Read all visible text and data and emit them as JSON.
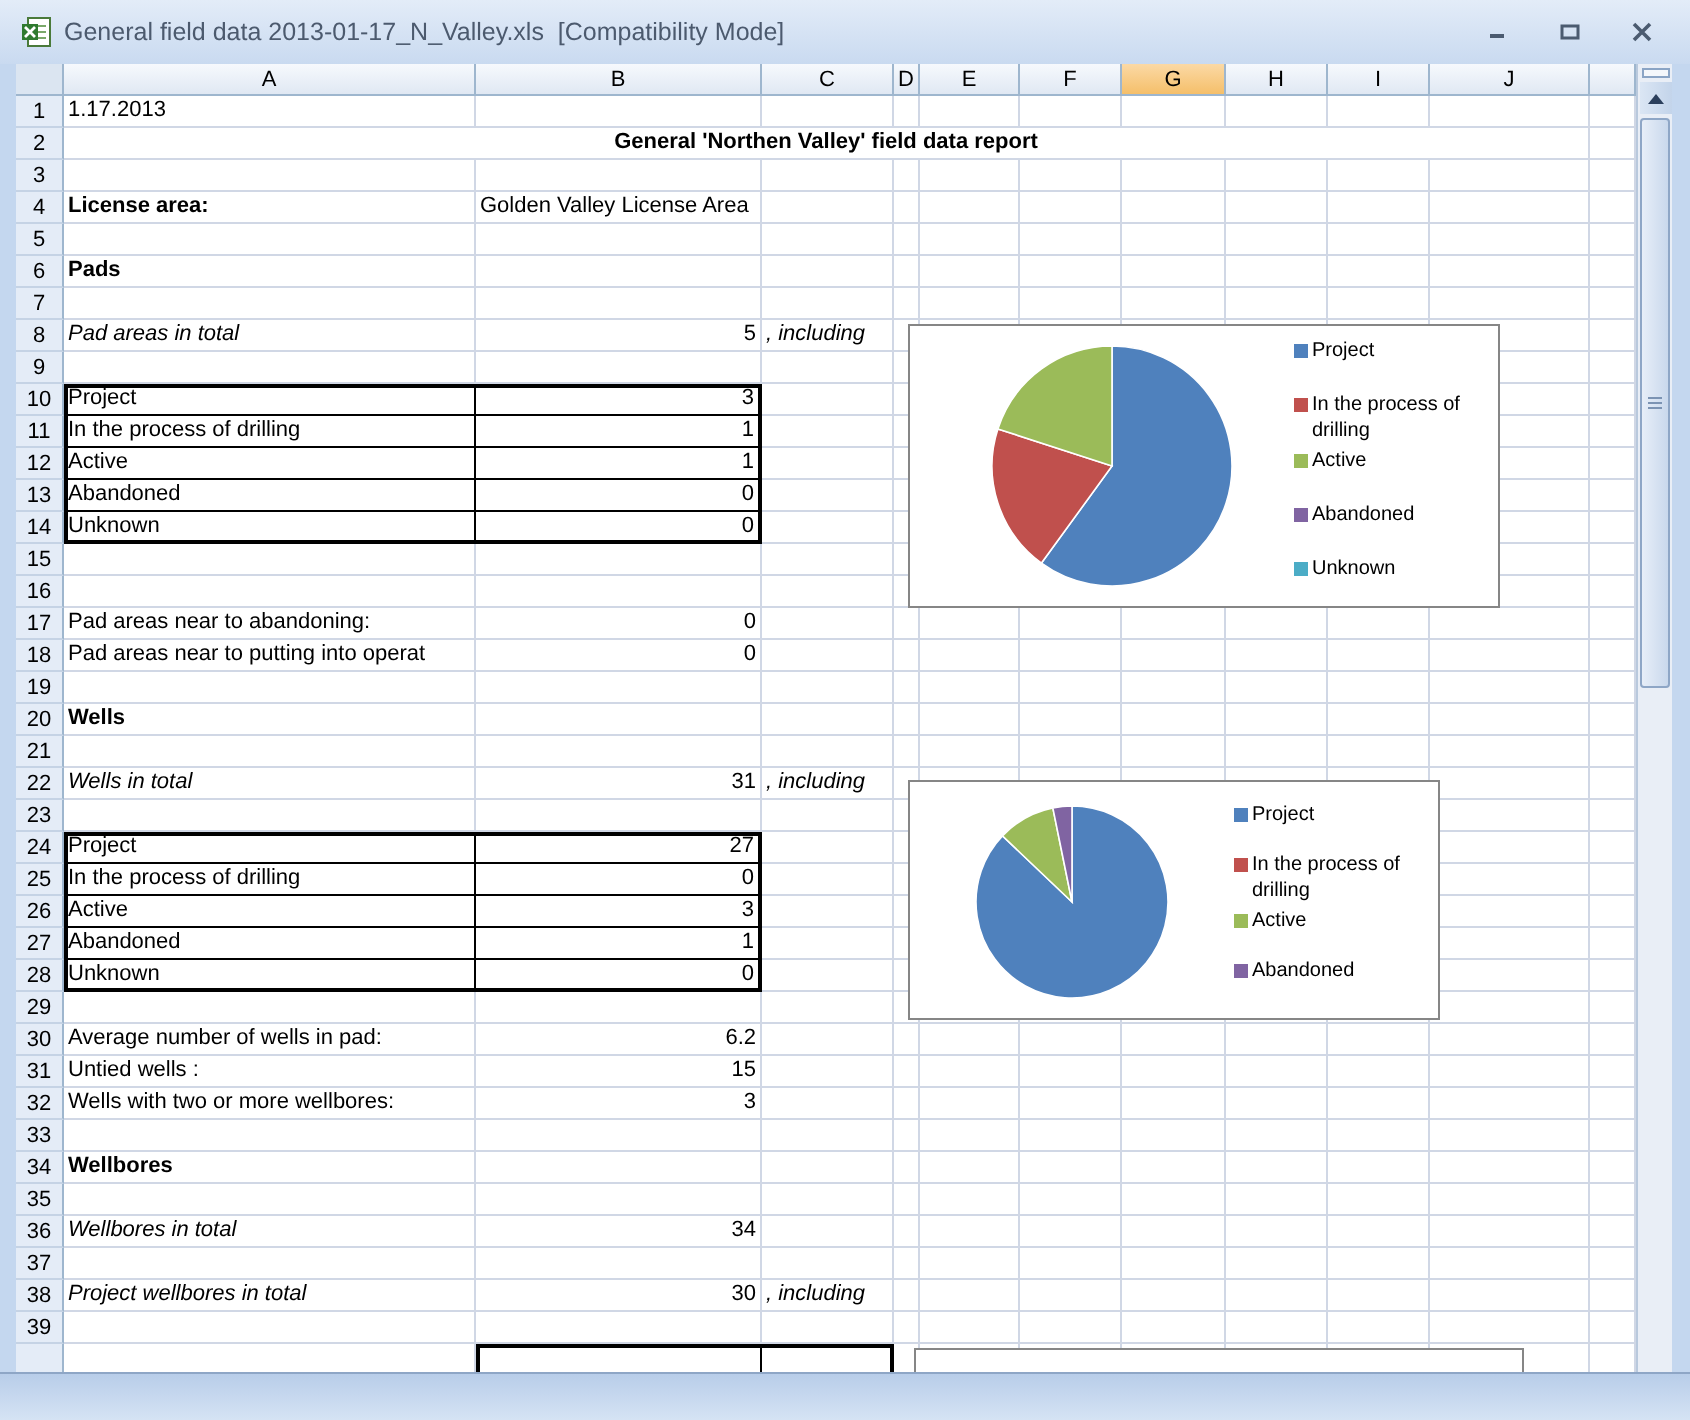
{
  "window": {
    "title": "General field data 2013-01-17_N_Valley.xls  [Compatibility Mode]"
  },
  "columns": [
    {
      "label": "A",
      "selected": false
    },
    {
      "label": "B",
      "selected": false
    },
    {
      "label": "C",
      "selected": false
    },
    {
      "label": "D",
      "selected": false
    },
    {
      "label": "E",
      "selected": false
    },
    {
      "label": "F",
      "selected": false
    },
    {
      "label": "G",
      "selected": true
    },
    {
      "label": "H",
      "selected": false
    },
    {
      "label": "I",
      "selected": false
    },
    {
      "label": "J",
      "selected": false
    }
  ],
  "rows": [
    {
      "number": "1",
      "kind": "plain",
      "cells": [
        "1.17.2013"
      ]
    },
    {
      "number": "2",
      "kind": "title",
      "cells": [
        "General 'Northen Valley' field data report"
      ]
    },
    {
      "number": "3",
      "kind": "plain"
    },
    {
      "number": "4",
      "kind": "label",
      "cells": [
        "License area:",
        "Golden Valley License Area"
      ]
    },
    {
      "number": "5",
      "kind": "plain"
    },
    {
      "number": "6",
      "kind": "heading",
      "cells": [
        "Pads"
      ]
    },
    {
      "number": "7",
      "kind": "plain"
    },
    {
      "number": "8",
      "kind": "total",
      "cells": [
        "Pad areas in total",
        "5",
        ", including"
      ]
    },
    {
      "number": "9",
      "kind": "plain"
    },
    {
      "number": "10",
      "kind": "table",
      "cells": [
        "Project",
        "3"
      ]
    },
    {
      "number": "11",
      "kind": "table",
      "cells": [
        "In the process of drilling",
        "1"
      ]
    },
    {
      "number": "12",
      "kind": "table",
      "cells": [
        "Active",
        "1"
      ]
    },
    {
      "number": "13",
      "kind": "table",
      "cells": [
        "Abandoned",
        "0"
      ]
    },
    {
      "number": "14",
      "kind": "table",
      "cells": [
        "Unknown",
        "0"
      ]
    },
    {
      "number": "15",
      "kind": "plain"
    },
    {
      "number": "16",
      "kind": "plain"
    },
    {
      "number": "17",
      "kind": "plain",
      "cells": [
        "Pad areas near to abandoning:",
        "0"
      ]
    },
    {
      "number": "18",
      "kind": "plain",
      "cells": [
        "Pad areas near to putting into operat",
        "0"
      ]
    },
    {
      "number": "19",
      "kind": "plain"
    },
    {
      "number": "20",
      "kind": "heading",
      "cells": [
        "Wells"
      ]
    },
    {
      "number": "21",
      "kind": "plain"
    },
    {
      "number": "22",
      "kind": "total",
      "cells": [
        "Wells in total",
        "31",
        ", including"
      ]
    },
    {
      "number": "23",
      "kind": "plain"
    },
    {
      "number": "24",
      "kind": "table",
      "cells": [
        "Project",
        "27"
      ]
    },
    {
      "number": "25",
      "kind": "table",
      "cells": [
        "In the process of drilling",
        "0"
      ]
    },
    {
      "number": "26",
      "kind": "table",
      "cells": [
        "Active",
        "3"
      ]
    },
    {
      "number": "27",
      "kind": "table",
      "cells": [
        "Abandoned",
        "1"
      ]
    },
    {
      "number": "28",
      "kind": "table",
      "cells": [
        "Unknown",
        "0"
      ]
    },
    {
      "number": "29",
      "kind": "plain"
    },
    {
      "number": "30",
      "kind": "plain",
      "cells": [
        "Average number of wells in pad:",
        "6.2"
      ]
    },
    {
      "number": "31",
      "kind": "plain",
      "cells": [
        "Untied wells :",
        "15"
      ]
    },
    {
      "number": "32",
      "kind": "plain",
      "cells": [
        "Wells with two or more wellbores:",
        "3"
      ]
    },
    {
      "number": "33",
      "kind": "plain"
    },
    {
      "number": "34",
      "kind": "heading",
      "cells": [
        "Wellbores"
      ]
    },
    {
      "number": "35",
      "kind": "plain"
    },
    {
      "number": "36",
      "kind": "total",
      "cells": [
        "Wellbores in total",
        "34"
      ]
    },
    {
      "number": "37",
      "kind": "plain"
    },
    {
      "number": "38",
      "kind": "total",
      "cells": [
        "Project wellbores in total",
        "30",
        ", including"
      ]
    },
    {
      "number": "39",
      "kind": "plain"
    },
    {
      "kind": "table_bc"
    }
  ],
  "charts": [
    {
      "kind": "chart",
      "chart_data": {
        "type": "pie",
        "legend": "right",
        "categories": [
          "Project",
          "In the process of drilling",
          "Active",
          "Abandoned",
          "Unknown"
        ],
        "series": [
          {
            "values": [
              60,
              20,
              20,
              0,
              0
            ]
          }
        ]
      }
    },
    {
      "kind": "chart",
      "chart_data": {
        "type": "pie",
        "legend": "right",
        "categories": [
          "Project",
          "In the process of drilling",
          "Active",
          "Abandoned"
        ],
        "series": [
          {
            "values": [
              87.1,
              0,
              9.7,
              3.2
            ]
          }
        ]
      }
    },
    {
      "kind": "frame"
    }
  ]
}
